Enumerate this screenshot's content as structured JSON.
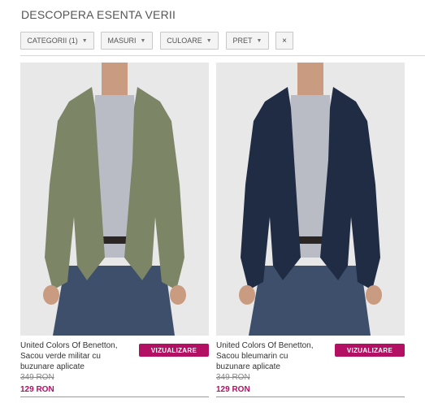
{
  "page": {
    "title": "DESCOPERA ESENTA VERII"
  },
  "filters": [
    {
      "label": "CATEGORII (1)"
    },
    {
      "label": "MASURI"
    },
    {
      "label": "CULOARE"
    },
    {
      "label": "PRET"
    }
  ],
  "clear_filter": {
    "symbol": "×"
  },
  "products": [
    {
      "name_lines": [
        "United Colors Of Benetton,",
        "Sacou verde militar cu",
        "buzunare aplicate"
      ],
      "old_price": "349 RON",
      "new_price": "129 RON",
      "button_label": "VIZUALIZARE",
      "jacket_color": "#7c8566"
    },
    {
      "name_lines": [
        "United Colors Of Benetton,",
        "Sacou bleumarin cu",
        "buzunare aplicate"
      ],
      "old_price": "349 RON",
      "new_price": "129 RON",
      "button_label": "VIZUALIZARE",
      "jacket_color": "#1f2c44"
    }
  ],
  "colors": {
    "accent": "#b30f63",
    "jeans": "#3d4f6b",
    "shirt": "#b9bcc4",
    "skin": "#c99b80"
  }
}
